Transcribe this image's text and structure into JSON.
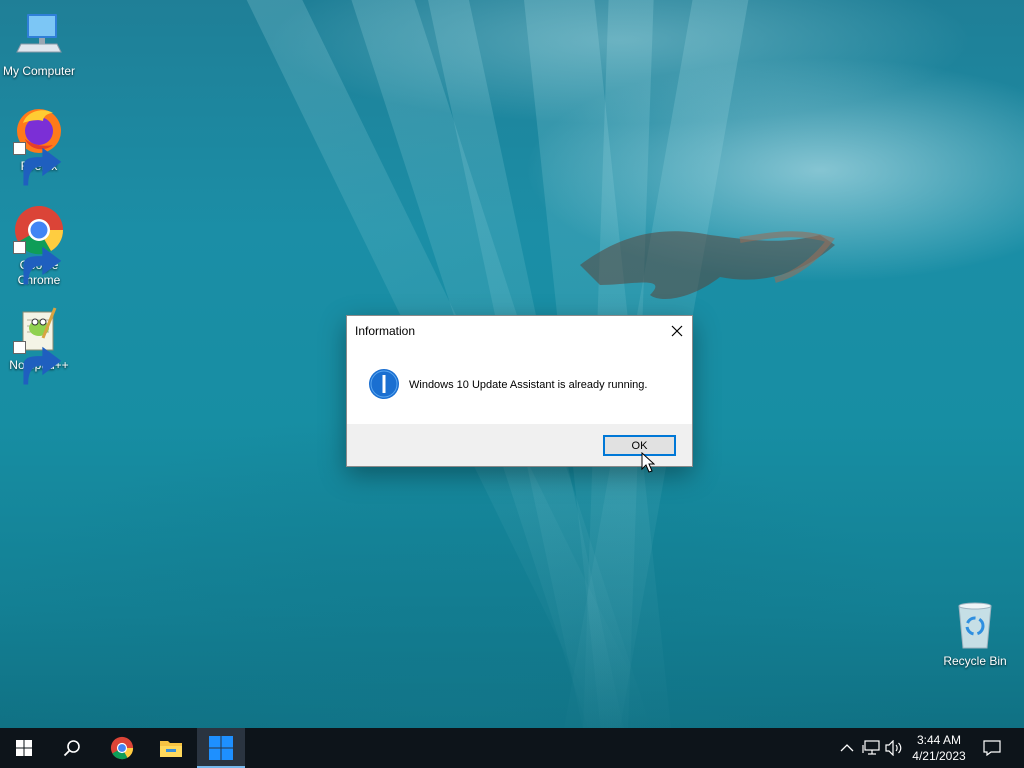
{
  "desktop": {
    "icons": [
      {
        "label": "My Computer",
        "icon": "my-computer-icon"
      },
      {
        "label": "Firefox",
        "icon": "firefox-icon"
      },
      {
        "label": "Google Chrome",
        "icon": "chrome-icon"
      },
      {
        "label": "Notepad++",
        "icon": "notepad-plus-plus-icon"
      },
      {
        "label": "Recycle Bin",
        "icon": "recycle-bin-icon"
      }
    ]
  },
  "dialog": {
    "title": "Information",
    "message": "Windows 10 Update Assistant is already running.",
    "ok_label": "OK",
    "icon": "info-icon"
  },
  "taskbar": {
    "items": [
      "start-icon",
      "search-icon",
      "chrome-icon",
      "file-explorer-icon",
      "update-assistant-icon"
    ],
    "tray": [
      "chevron-up-icon",
      "network-icon",
      "volume-icon",
      "notification-icon"
    ],
    "time": "3:44 AM",
    "date": "4/21/2023",
    "accent": "#76b9ed"
  },
  "colors": {
    "desktop_water": "#1b8ea6",
    "taskbar_bg": "#0d141a",
    "dialog_footer": "#f0f0f0",
    "button_border": "#0078d7"
  }
}
